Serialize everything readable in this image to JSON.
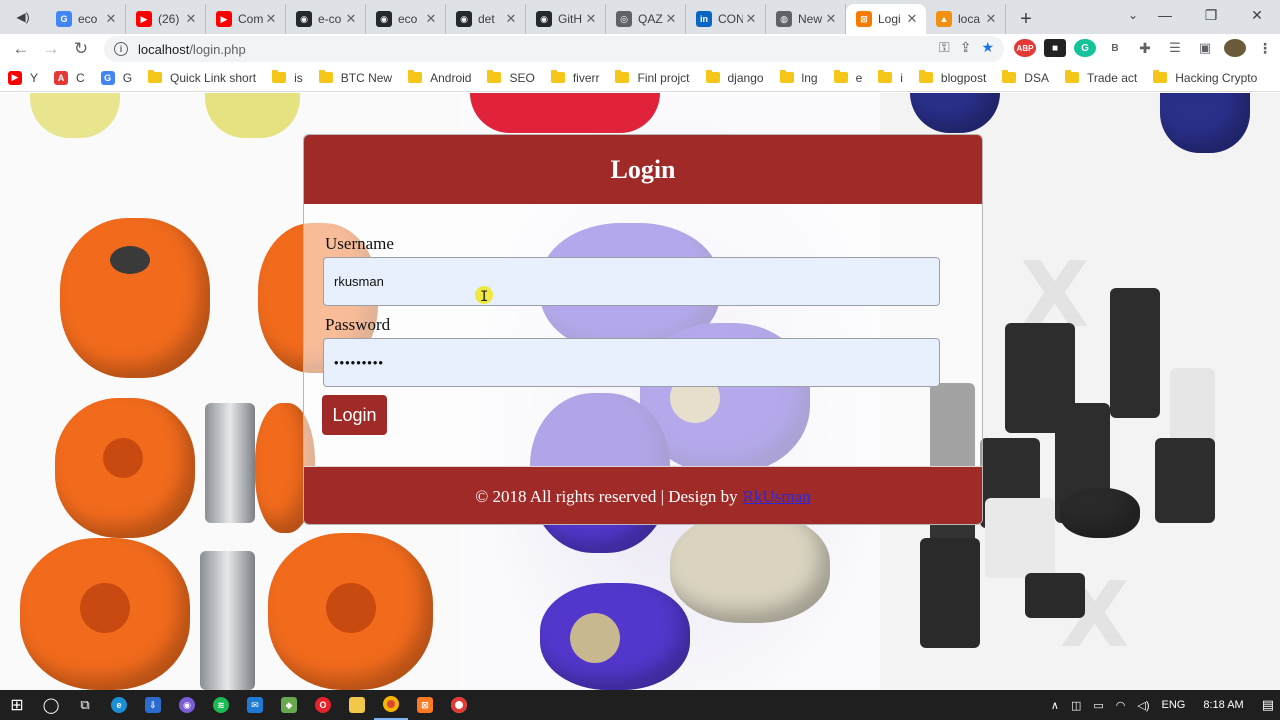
{
  "browser": {
    "tabs": [
      {
        "title": "eco",
        "color": "#4285f4",
        "glyph": "G"
      },
      {
        "title": "(26)",
        "color": "#ff0000",
        "glyph": "▶"
      },
      {
        "title": "Com",
        "color": "#ff0000",
        "glyph": "▶"
      },
      {
        "title": "e-co",
        "color": "#24292f",
        "glyph": "◉"
      },
      {
        "title": "eco",
        "color": "#24292f",
        "glyph": "◉"
      },
      {
        "title": "det",
        "color": "#24292f",
        "glyph": "◉"
      },
      {
        "title": "GitH",
        "color": "#24292f",
        "glyph": "◉"
      },
      {
        "title": "QAZ",
        "color": "#5f6368",
        "glyph": "◎"
      },
      {
        "title": "CON",
        "color": "#0a66c2",
        "glyph": "in"
      },
      {
        "title": "New",
        "color": "#5f6368",
        "glyph": "◍"
      },
      {
        "title": "Logi",
        "color": "#f57c00",
        "glyph": "⊠",
        "active": true
      },
      {
        "title": "loca",
        "color": "#f29111",
        "glyph": "▲"
      }
    ],
    "new_tab": "+",
    "url_host": "localhost",
    "url_path": "/login.php",
    "bookmarks": [
      {
        "label": "Y",
        "icon": "youtube",
        "color": "#ff0000"
      },
      {
        "label": "C",
        "icon": "a",
        "color": "#e53935"
      },
      {
        "label": "G",
        "icon": "google",
        "color": "#4285f4"
      },
      {
        "label": "Quick Link short",
        "icon": "folder"
      },
      {
        "label": "is",
        "icon": "folder"
      },
      {
        "label": "BTC New",
        "icon": "folder"
      },
      {
        "label": "Android",
        "icon": "folder"
      },
      {
        "label": "SEO",
        "icon": "folder"
      },
      {
        "label": "fiverr",
        "icon": "folder"
      },
      {
        "label": "Finl projct",
        "icon": "folder"
      },
      {
        "label": "django",
        "icon": "folder"
      },
      {
        "label": "lng",
        "icon": "folder"
      },
      {
        "label": "e",
        "icon": "folder"
      },
      {
        "label": "i",
        "icon": "folder"
      },
      {
        "label": "blogpost",
        "icon": "folder"
      },
      {
        "label": "DSA",
        "icon": "folder"
      },
      {
        "label": "Trade act",
        "icon": "folder"
      },
      {
        "label": "Hacking Crypto",
        "icon": "folder"
      }
    ]
  },
  "login": {
    "title": "Login",
    "username_label": "Username",
    "username_value": "rkusman",
    "password_label": "Password",
    "password_value": "•••••••••",
    "button_label": "Login",
    "footer_text": "© 2018 All rights reserved | Design by",
    "footer_link": "RkUsman"
  },
  "taskbar": {
    "language": "ENG",
    "time": "8:18 AM"
  },
  "colors": {
    "header_red": "#a02a27",
    "field_bg": "#e8f0fe",
    "link_blue": "#2b2bd6"
  }
}
